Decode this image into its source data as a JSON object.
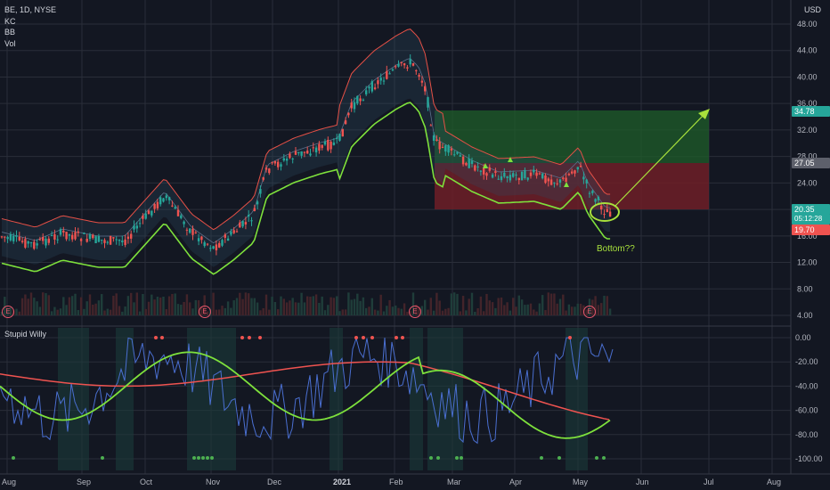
{
  "header": {
    "symbol": "BE, 1D, NYSE",
    "indicators": [
      "KC",
      "BB",
      "Vol"
    ],
    "currency": "USD"
  },
  "main_axis": {
    "ticks": [
      "48.00",
      "44.00",
      "40.00",
      "36.00",
      "32.00",
      "28.00",
      "24.00",
      "20.00",
      "16.00",
      "12.00",
      "8.00",
      "4.00"
    ],
    "tick_values": [
      48,
      44,
      40,
      36,
      32,
      28,
      24,
      20,
      16,
      12,
      8,
      4
    ]
  },
  "price_labels": {
    "target": "34.78",
    "current": "27.05",
    "last": "20.35",
    "countdown": "05:12:28",
    "stop": "19.70"
  },
  "colors": {
    "background": "#131722",
    "bull": "#26a69a",
    "bear": "#ef5350",
    "target_zone": "#1b5e20",
    "stop_zone": "#7f1d1d",
    "outer_band": "#e65046",
    "inner_band": "#7ee13c",
    "annotation": "#a8e13c"
  },
  "annotation": {
    "text": "Bottom??"
  },
  "earnings_marker": "E",
  "date_axis": [
    "Aug",
    "Sep",
    "Oct",
    "Nov",
    "Dec",
    "2021",
    "Feb",
    "Mar",
    "Apr",
    "May",
    "Jun",
    "Jul",
    "Aug"
  ],
  "oscillator": {
    "title": "Stupid Willy",
    "ticks": [
      "0.00",
      "-20.00",
      "-40.00",
      "-60.00",
      "-80.00",
      "-100.00"
    ],
    "tick_values": [
      0,
      -20,
      -40,
      -60,
      -80,
      -100
    ]
  },
  "chart_data": {
    "type": "line",
    "symbol": "BE",
    "interval": "1D",
    "exchange": "NYSE",
    "x": [
      "Aug",
      "Sep",
      "Oct",
      "Nov",
      "Dec",
      "2021",
      "Feb",
      "Mar",
      "Apr",
      "May"
    ],
    "series": [
      {
        "values": [
          16.5,
          14.5,
          18.0,
          13.5,
          26.0,
          32.0,
          43.0,
          26.0,
          25.0,
          20.3
        ]
      }
    ],
    "ylim": [
      4,
      48
    ],
    "trade": {
      "entry": 27.05,
      "target": 34.78,
      "stop": 19.7
    },
    "oscillator_ylim": [
      -100,
      0
    ]
  }
}
